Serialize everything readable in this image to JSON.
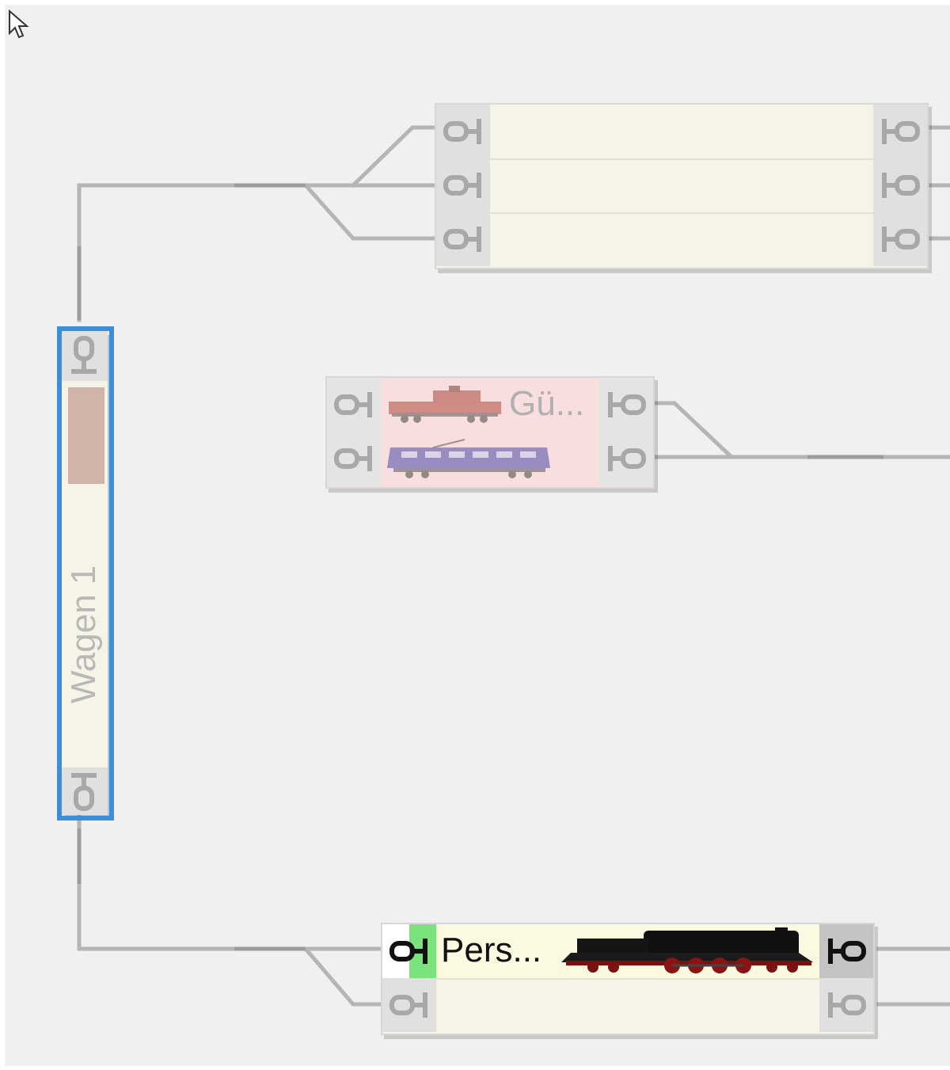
{
  "blocks": {
    "top": {
      "rows": [
        {
          "label": ""
        },
        {
          "label": ""
        },
        {
          "label": ""
        }
      ]
    },
    "middle": {
      "label": "Gü...",
      "rows": [
        {
          "icon": "red-diesel-locomotive-icon"
        },
        {
          "icon": "blue-electric-locomotive-icon"
        }
      ]
    },
    "bottom": {
      "label": "Pers...",
      "rows": [
        {
          "icon": "steam-locomotive-icon",
          "state": "active"
        },
        {
          "icon": ""
        }
      ]
    },
    "vertical": {
      "label": "Wagen 1",
      "selected": true
    }
  },
  "colors": {
    "canvas": "#f0f0f0",
    "block_fill": "#f5f4e6",
    "selection": "#3a8fd8",
    "active_green": "#7be37b",
    "faded_fill": "#f8dede",
    "track": "#b5b5b5"
  }
}
